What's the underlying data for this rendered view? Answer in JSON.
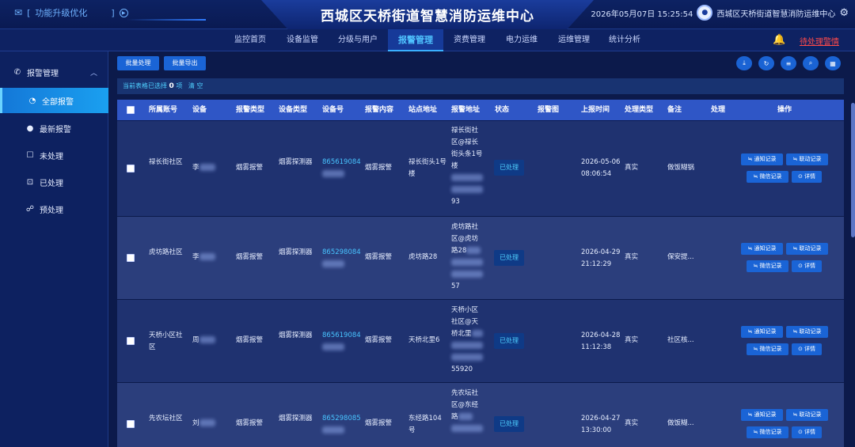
{
  "header": {
    "feature_label": "功能升级优化",
    "bracket": "]",
    "title": "西城区天桥街道智慧消防运维中心",
    "datetime": "2026年05月07日 15:25:54",
    "org": "西城区天桥街道智慧消防运维中心"
  },
  "nav": {
    "items": [
      "监控首页",
      "设备监管",
      "分级与用户",
      "报警管理",
      "资费管理",
      "电力运维",
      "运维管理",
      "统计分析"
    ],
    "active": "报警管理",
    "pending_alerts": "待处理警情"
  },
  "sidebar": {
    "section": "报警管理",
    "items": [
      "全部报警",
      "最新报警",
      "未处理",
      "已处理",
      "预处理"
    ],
    "active": "全部报警"
  },
  "toolbar": {
    "batch_process": "批量处理",
    "batch_export": "批量导出",
    "icons": [
      "download-icon",
      "refresh-icon",
      "filter-icon",
      "search-icon",
      "columns-icon"
    ]
  },
  "selection": {
    "prefix": "当前表格已选择",
    "count": "0",
    "suffix": "项",
    "clear": "清 空"
  },
  "table": {
    "headers": [
      "所属账号",
      "设备",
      "报警类型",
      "设备类型",
      "设备号",
      "报警内容",
      "站点地址",
      "报警地址",
      "状态",
      "报警图",
      "上报时间",
      "处理类型",
      "备注",
      "处理",
      "操作"
    ],
    "rows": [
      {
        "account": "禄长街社区",
        "device": "李",
        "alarm_type": "烟雾报警",
        "device_type": "烟雾探测器",
        "device_no": "865619084",
        "content": "烟雾报警",
        "site": "禄长街头1号楼",
        "address_l1": "禄长街社",
        "address_l2": "区@禄长",
        "address_l3": "街头条1号",
        "address_l4": "楼",
        "address_tail": "93",
        "status": "已处理",
        "time": "2026-05-06 08:06:54",
        "handle_type": "真实",
        "remark": "做饭糊锅"
      },
      {
        "account": "虎坊路社区",
        "device": "李",
        "alarm_type": "烟雾报警",
        "device_type": "烟雾探测器",
        "device_no": "865298084",
        "content": "烟雾报警",
        "site": "虎坊路28",
        "address_l1": "虎坊路社",
        "address_l2": "区@虎坊",
        "address_l3": "路28",
        "address_l4": "",
        "address_tail": "57",
        "status": "已处理",
        "time": "2026-04-29 21:12:29",
        "handle_type": "真实",
        "remark": "保安提..."
      },
      {
        "account": "天桥小区社区",
        "device": "周",
        "alarm_type": "烟雾报警",
        "device_type": "烟雾探测器",
        "device_no": "865619084",
        "content": "烟雾报警",
        "site": "天桥北里6",
        "address_l1": "天桥小区",
        "address_l2": "社区@天",
        "address_l3": "桥北里",
        "address_l4": "",
        "address_tail": "55920",
        "status": "已处理",
        "time": "2026-04-28 11:12:38",
        "handle_type": "真实",
        "remark": "社区核..."
      },
      {
        "account": "先农坛社区",
        "device": "刘",
        "alarm_type": "烟雾报警",
        "device_type": "烟雾探测器",
        "device_no": "865298085",
        "content": "烟雾报警",
        "site": "东经路104号",
        "address_l1": "先农坛社",
        "address_l2": "区@东经",
        "address_l3": "路",
        "address_l4": "",
        "address_tail": "",
        "status": "已处理",
        "time": "2026-04-27 13:30:00",
        "handle_type": "真实",
        "remark": "做饭糊..."
      }
    ],
    "actions": [
      "通知记录",
      "联动记录",
      "微信记录",
      "详情"
    ]
  }
}
